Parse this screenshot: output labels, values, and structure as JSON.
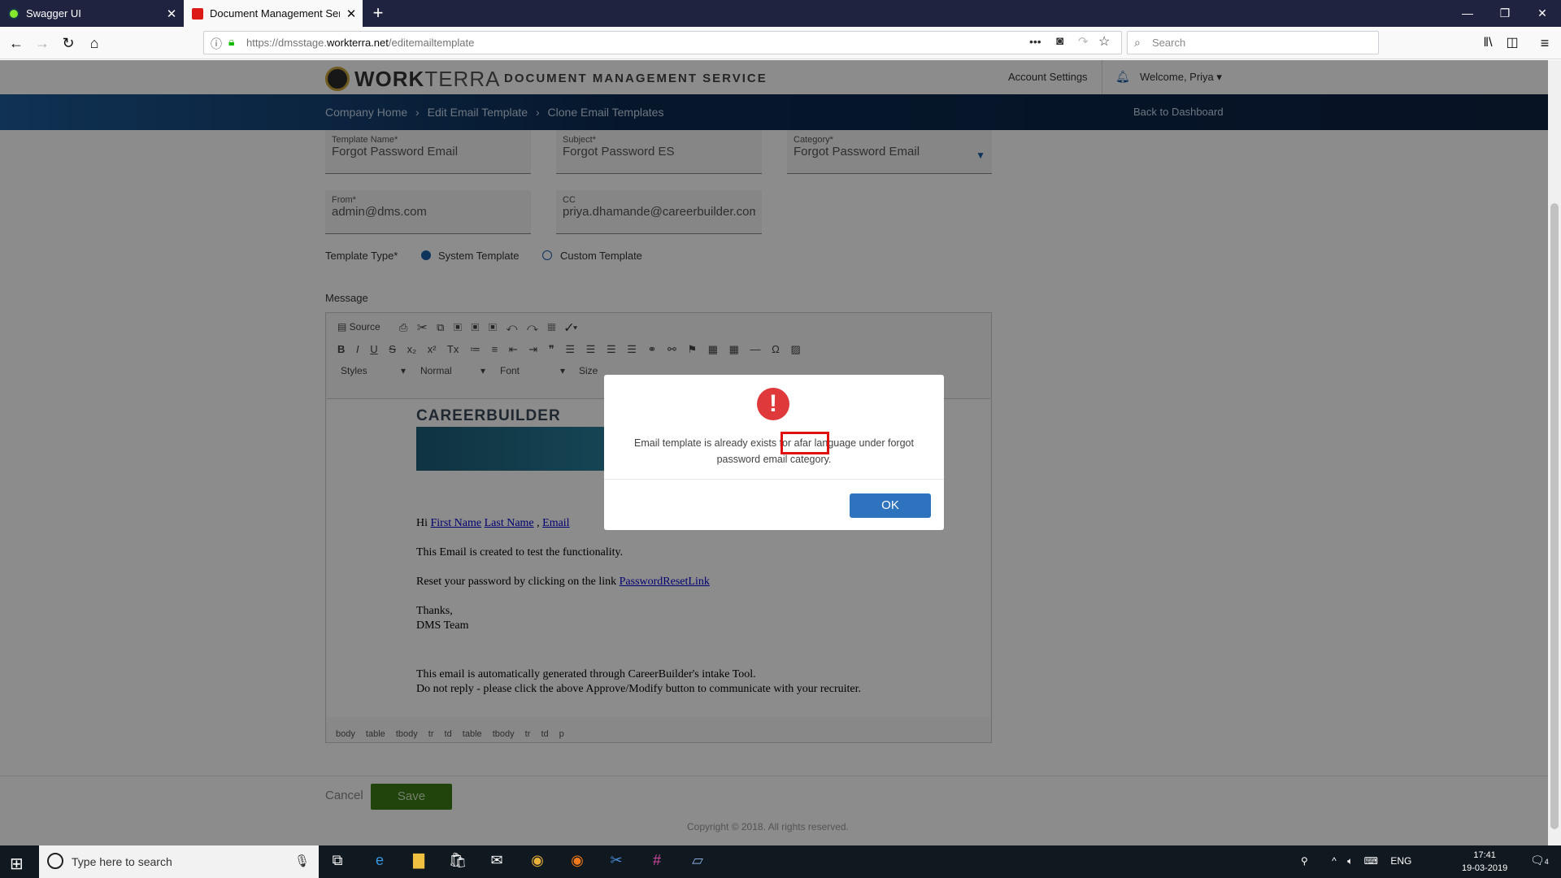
{
  "browser": {
    "tabs": [
      {
        "label": "Swagger UI"
      },
      {
        "label": "Document Management Servic"
      }
    ],
    "url_prefix": "https://dmsstage.",
    "url_domain": "workterra.net",
    "url_path": "/editemailtemplate",
    "search_placeholder": "Search"
  },
  "app": {
    "brand_bold": "WORK",
    "brand_light": "TERRA",
    "service_name": "DOCUMENT MANAGEMENT SERVICE",
    "account_settings": "Account Settings",
    "welcome": "Welcome, Priya",
    "breadcrumb": [
      "Company Home",
      "Edit Email Template",
      "Clone Email Templates"
    ],
    "back_to_dashboard": "Back to Dashboard"
  },
  "form": {
    "template_name_label": "Template Name*",
    "template_name_value": "Forgot Password Email",
    "subject_label": "Subject*",
    "subject_value": "Forgot Password ES",
    "category_label": "Category*",
    "category_value": "Forgot Password Email",
    "from_label": "From*",
    "from_value": "admin@dms.com",
    "cc_label": "CC",
    "cc_value": "priya.dhamande@careerbuilder.com",
    "template_type_label": "Template Type*",
    "system_template": "System Template",
    "custom_template": "Custom Template",
    "message_label": "Message"
  },
  "editor": {
    "source": "Source",
    "styles": "Styles",
    "format": "Normal",
    "font": "Font",
    "size": "Size",
    "logo_text": "CAREERBUILDER",
    "greeting": "Hi",
    "first_name": "First Name",
    "last_name": "Last Name",
    "email": "Email",
    "line1": "This Email is created to test the functionality.",
    "line2": "Reset your password by clicking on the link",
    "reset_link": "PasswordResetLink",
    "thanks": "Thanks,",
    "team": "DMS Team",
    "footer1": "This email is automatically generated through CareerBuilder's intake Tool.",
    "footer2": "Do not reply - please click the above Approve/Modify button to communicate with your recruiter.",
    "element_path": "body table tbody tr td table tbody tr td p"
  },
  "actions": {
    "cancel": "Cancel",
    "save": "Save",
    "copyright": "Copyright © 2018. All rights reserved."
  },
  "modal": {
    "message": "Email template is already exists for afar language under forgot password email category.",
    "ok": "OK"
  },
  "taskbar": {
    "search_placeholder": "Type here to search",
    "language": "ENG",
    "time": "17:41",
    "date": "19-03-2019",
    "notifications": "4"
  }
}
